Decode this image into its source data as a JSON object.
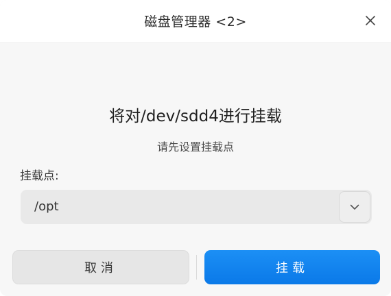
{
  "window": {
    "title": "磁盘管理器 <2>"
  },
  "icons": {
    "close": "close-icon",
    "dropdown": "chevron-down-icon"
  },
  "content": {
    "heading": "将对/dev/sdd4进行挂载",
    "subheading": "请先设置挂载点",
    "mount_point_label": "挂载点:",
    "mount_point_value": "/opt"
  },
  "buttons": {
    "cancel_label": "取消",
    "mount_label": "挂载"
  },
  "colors": {
    "accent": "#0a79e8",
    "primary_button_text": "#ffffff"
  }
}
